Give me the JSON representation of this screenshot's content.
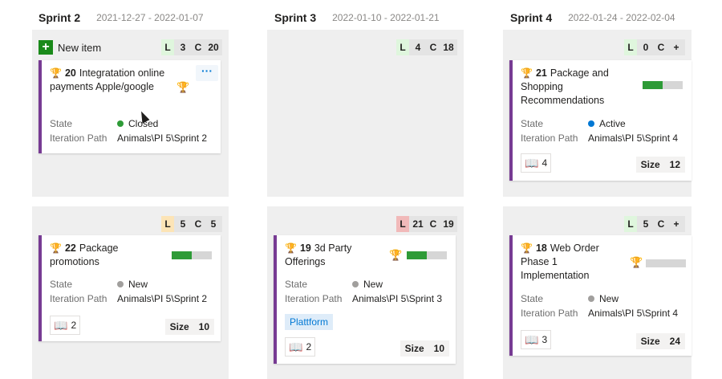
{
  "columns": [
    {
      "title": "Sprint 2",
      "dates": "2021-12-27 - 2022-01-07"
    },
    {
      "title": "Sprint 3",
      "dates": "2022-01-10 - 2022-01-21"
    },
    {
      "title": "Sprint 4",
      "dates": "2022-01-24 - 2022-02-04"
    }
  ],
  "new_item_label": "New item",
  "field_labels": {
    "state": "State",
    "iteration": "Iteration Path",
    "size": "Size"
  },
  "colors": {
    "load_ok": "#dff6dd",
    "load_warn": "#fce4b6",
    "load_over": "#f1b9b9",
    "capacity": "#dde6f5",
    "accent": "#773b93"
  },
  "cells": [
    {
      "load_key": "L",
      "load": "3",
      "cap_key": "C",
      "cap": "20",
      "load_color": "#dff6dd"
    },
    {
      "load_key": "L",
      "load": "4",
      "cap_key": "C",
      "cap": "18",
      "load_color": "#dff6dd"
    },
    {
      "load_key": "L",
      "load": "0",
      "cap_key": "C",
      "cap": "+",
      "load_color": "#dff6dd"
    },
    {
      "load_key": "L",
      "load": "5",
      "cap_key": "C",
      "cap": "5",
      "load_color": "#fce4b6"
    },
    {
      "load_key": "L",
      "load": "21",
      "cap_key": "C",
      "cap": "19",
      "load_color": "#f1b9b9"
    },
    {
      "load_key": "L",
      "load": "5",
      "cap_key": "C",
      "cap": "+",
      "load_color": "#dff6dd"
    }
  ],
  "cards": {
    "c20": {
      "id": "20",
      "title": "Integratation online payments Apple/google",
      "state": "Closed",
      "iteration": "Animals\\PI 5\\Sprint 2",
      "more": "···"
    },
    "c21": {
      "id": "21",
      "title": "Package and Shopping Recommendations",
      "state": "Active",
      "iteration": "Animals\\PI 5\\Sprint 4",
      "links": "4",
      "size": "12",
      "progress": 0.5
    },
    "c22": {
      "id": "22",
      "title": "Package promotions",
      "state": "New",
      "iteration": "Animals\\PI 5\\Sprint 2",
      "links": "2",
      "size": "10",
      "progress": 0.5
    },
    "c19": {
      "id": "19",
      "title": "3d Party Offerings",
      "state": "New",
      "iteration": "Animals\\PI 5\\Sprint 3",
      "tag": "Plattform",
      "links": "2",
      "size": "10",
      "progress": 0.5
    },
    "c18": {
      "id": "18",
      "title": "Web Order Phase 1 Implementation",
      "state": "New",
      "iteration": "Animals\\PI 5\\Sprint 4",
      "links": "3",
      "size": "24",
      "progress": 0
    }
  },
  "icons": {
    "trophy": "🏆",
    "book": "📖",
    "plus": "+"
  }
}
